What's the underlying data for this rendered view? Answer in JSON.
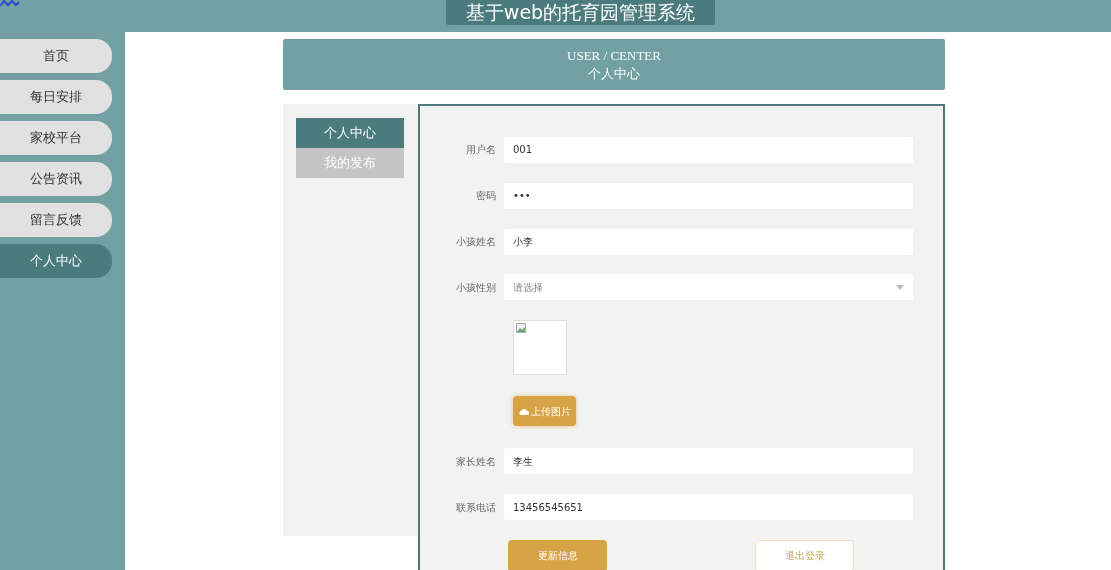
{
  "header": {
    "title": "基于web的托育园管理系统"
  },
  "nav": [
    {
      "label": "首页",
      "selected": false
    },
    {
      "label": "每日安排",
      "selected": false
    },
    {
      "label": "家校平台",
      "selected": false
    },
    {
      "label": "公告资讯",
      "selected": false
    },
    {
      "label": "留言反馈",
      "selected": false
    },
    {
      "label": "个人中心",
      "selected": true
    }
  ],
  "section_heading": {
    "english": "USER / CENTER",
    "chinese": "个人中心"
  },
  "side_tabs": [
    {
      "label": "个人中心",
      "selected": true
    },
    {
      "label": "我的发布",
      "selected": false
    }
  ],
  "form": [
    {
      "kind": "text",
      "label": "用户名",
      "value": "001"
    },
    {
      "kind": "text",
      "label": "密码",
      "value": "•••"
    },
    {
      "kind": "text",
      "label": "小孩姓名",
      "value": "小李"
    },
    {
      "kind": "select",
      "label": "小孩性别",
      "placeholder": "请选择"
    },
    {
      "kind": "image",
      "button": "上传图片"
    },
    {
      "kind": "text",
      "label": "家长姓名",
      "value": "李生"
    },
    {
      "kind": "text",
      "label": "联系电话",
      "value": "13456545651"
    }
  ],
  "buttons": [
    {
      "kind": "primary",
      "label": "更新信息"
    },
    {
      "kind": "outline",
      "label": "退出登录"
    }
  ]
}
